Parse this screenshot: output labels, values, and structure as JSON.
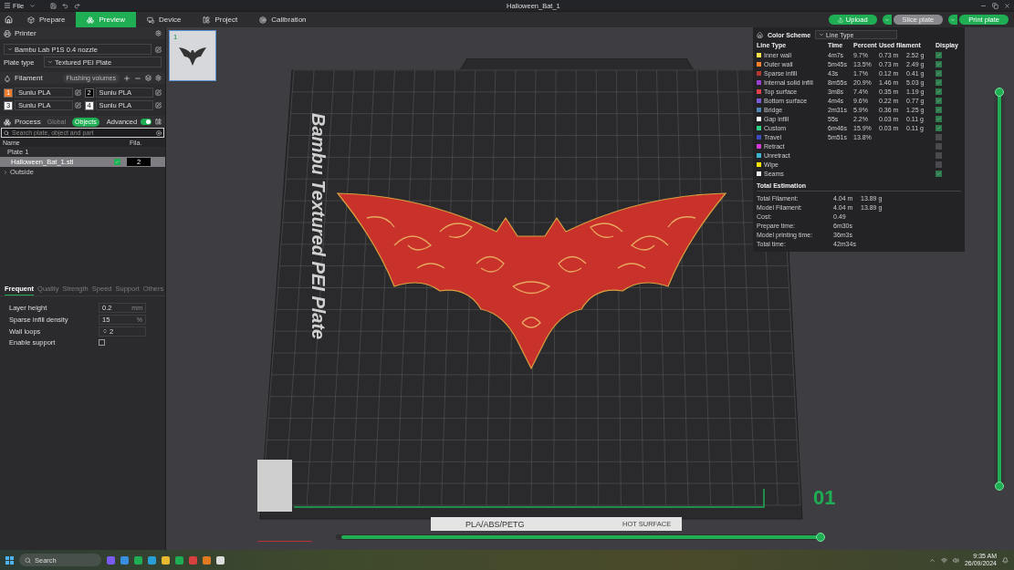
{
  "window": {
    "title": "Halloween_Bat_1",
    "menu": "File"
  },
  "tabs": [
    {
      "label": "Prepare",
      "kind": "prepare",
      "selected": false
    },
    {
      "label": "Preview",
      "kind": "preview",
      "selected": true
    },
    {
      "label": "Device",
      "kind": "device",
      "selected": false
    },
    {
      "label": "Project",
      "kind": "project",
      "selected": false
    },
    {
      "label": "Calibration",
      "kind": "calibration",
      "selected": false
    }
  ],
  "actions": [
    {
      "label": "Upload",
      "kind": "plain",
      "disabled": false
    },
    {
      "label": "Slice plate",
      "kind": "split",
      "disabled": true
    },
    {
      "label": "Print plate",
      "kind": "split",
      "disabled": false
    }
  ],
  "printer": {
    "title": "Printer",
    "model": "Bambu Lab P1S 0.4 nozzle",
    "plate_type_label": "Plate type",
    "plate_type": "Textured PEI Plate"
  },
  "filament": {
    "title": "Filament",
    "flushing_button": "Flushing volumes",
    "slots": [
      {
        "number": "1",
        "name": "Sunlu PLA",
        "color": "#f07a2a"
      },
      {
        "number": "2",
        "name": "Sunlu PLA",
        "color": "#000000"
      },
      {
        "number": "3",
        "name": "Sunlu PLA",
        "color": "#ffffff"
      },
      {
        "number": "4",
        "name": "Sunlu PLA",
        "color": "#ffffff"
      }
    ]
  },
  "process": {
    "title": "Process",
    "modes": [
      {
        "label": "Global",
        "selected": false
      },
      {
        "label": "Objects",
        "selected": true
      }
    ],
    "advanced_label": "Advanced",
    "advanced_on": true,
    "search_placeholder": "Search plate, object and part",
    "columns": [
      "Name",
      "Fila."
    ],
    "tree": [
      {
        "label": "Plate 1",
        "expanded": true,
        "children": [
          {
            "label": "Halloween_Bat_1.stl",
            "selected": true,
            "checked": true,
            "filament": "2"
          }
        ]
      },
      {
        "label": "Outside",
        "expanded": false
      }
    ]
  },
  "settings_tabs": [
    {
      "label": "Frequent",
      "selected": true
    },
    {
      "label": "Quality",
      "selected": false
    },
    {
      "label": "Strength",
      "selected": false
    },
    {
      "label": "Speed",
      "selected": false
    },
    {
      "label": "Support",
      "selected": false
    },
    {
      "label": "Others",
      "selected": false
    }
  ],
  "settings": [
    {
      "kind": "number",
      "label": "Layer height",
      "value": "0.2",
      "unit": "mm"
    },
    {
      "kind": "number",
      "label": "Sparse infill density",
      "value": "15",
      "unit": "%"
    },
    {
      "kind": "spin",
      "label": "Wall loops",
      "value": "2"
    },
    {
      "kind": "checkbox",
      "label": "Enable support",
      "checked": false
    }
  ],
  "plate": {
    "thumbnail_number": "1",
    "bed_label": "Bambu Textured PEI Plate",
    "plate_tag": "PLA/ABS/PETG",
    "warning": "HOT SURFACE",
    "layer_number": "01"
  },
  "legend": {
    "title": "Color Scheme",
    "scheme": "Line Type",
    "columns": [
      "Line Type",
      "Time",
      "Percent",
      "Used filament",
      "Display"
    ],
    "rows": [
      {
        "name": "Inner wall",
        "color": "#ffe34d",
        "time": "4m7s",
        "percent": "9.7%",
        "length": "0.73 m",
        "weight": "2.52 g",
        "checked": true
      },
      {
        "name": "Outer wall",
        "color": "#ff7f2a",
        "time": "5m45s",
        "percent": "13.5%",
        "length": "0.73 m",
        "weight": "2.49 g",
        "checked": true
      },
      {
        "name": "Sparse infill",
        "color": "#b03a2e",
        "time": "43s",
        "percent": "1.7%",
        "length": "0.12 m",
        "weight": "0.41 g",
        "checked": true
      },
      {
        "name": "Internal solid infill",
        "color": "#9a3fd4",
        "time": "8m55s",
        "percent": "20.9%",
        "length": "1.46 m",
        "weight": "5.03 g",
        "checked": true
      },
      {
        "name": "Top surface",
        "color": "#e6414b",
        "time": "3m8s",
        "percent": "7.4%",
        "length": "0.35 m",
        "weight": "1.19 g",
        "checked": true
      },
      {
        "name": "Bottom surface",
        "color": "#7a5cd6",
        "time": "4m4s",
        "percent": "9.6%",
        "length": "0.22 m",
        "weight": "0.77 g",
        "checked": true
      },
      {
        "name": "Bridge",
        "color": "#4f87b8",
        "time": "2m31s",
        "percent": "5.9%",
        "length": "0.36 m",
        "weight": "1.25 g",
        "checked": true
      },
      {
        "name": "Gap infill",
        "color": "#ffffff",
        "time": "55s",
        "percent": "2.2%",
        "length": "0.03 m",
        "weight": "0.11 g",
        "checked": true
      },
      {
        "name": "Custom",
        "color": "#2fcf88",
        "time": "6m46s",
        "percent": "15.9%",
        "length": "0.03 m",
        "weight": "0.11 g",
        "checked": true
      },
      {
        "name": "Travel",
        "color": "#3b4cc0",
        "time": "5m51s",
        "percent": "13.8%",
        "checked": false
      },
      {
        "name": "Retract",
        "color": "#d63ad6",
        "checked": false
      },
      {
        "name": "Unretract",
        "color": "#3fb5d6",
        "checked": false
      },
      {
        "name": "Wipe",
        "color": "#ffe800",
        "checked": false
      },
      {
        "name": "Seams",
        "color": "#f0f0f0",
        "checked": true
      }
    ],
    "estimation_title": "Total Estimation",
    "estimation": [
      {
        "label": "Total Filament:",
        "value": "4.04 m",
        "extra": "13.89 g"
      },
      {
        "label": "Model Filament:",
        "value": "4.04 m",
        "extra": "13.89 g"
      },
      {
        "label": "Cost:",
        "value": "0.49"
      },
      {
        "label": "Prepare time:",
        "value": "6m30s"
      },
      {
        "label": "Model printing time:",
        "value": "36m3s"
      },
      {
        "label": "Total time:",
        "value": "42m34s"
      }
    ]
  },
  "layer_slider": {
    "level": 1
  },
  "move_slider": {
    "level": 1
  },
  "taskbar": {
    "search_placeholder": "Search",
    "time": "9:35 AM",
    "date": "26/09/2024"
  }
}
